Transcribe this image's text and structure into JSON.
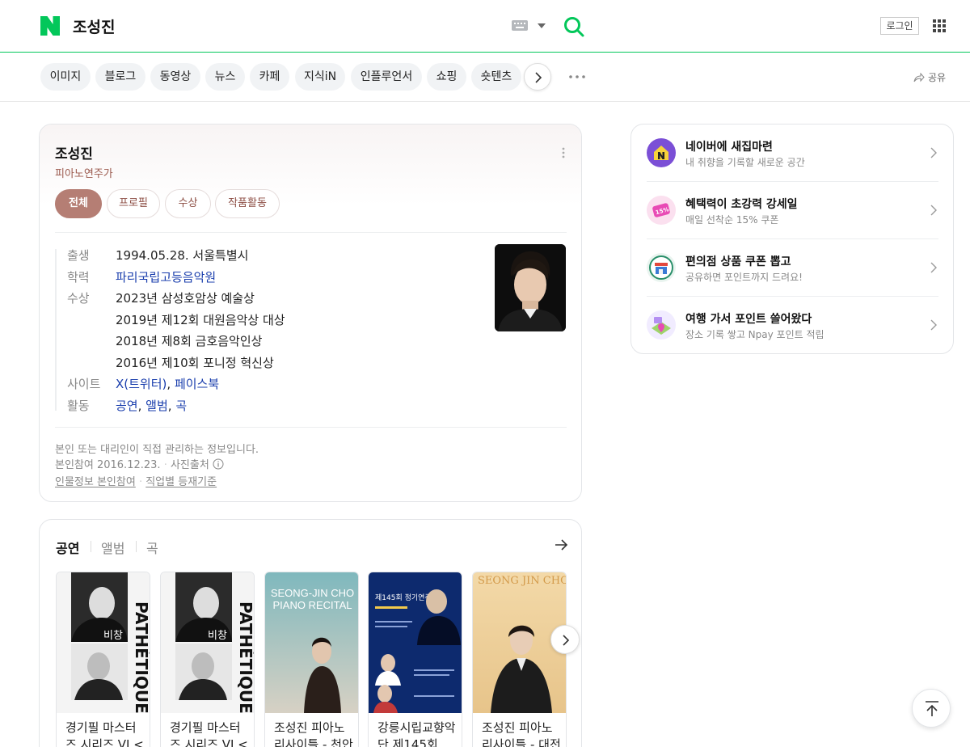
{
  "header": {
    "query": "조성진",
    "login_label": "로그인"
  },
  "tabs": [
    "이미지",
    "블로그",
    "동영상",
    "뉴스",
    "카페",
    "지식iN",
    "인플루언서",
    "쇼핑",
    "숏텐츠"
  ],
  "share_label": "공유",
  "profile": {
    "name": "조성진",
    "job": "피아노연주가",
    "tabs": [
      "전체",
      "프로필",
      "수상",
      "작품활동"
    ],
    "rows": {
      "birth_label": "출생",
      "birth_value": "1994.05.28. 서울특별시",
      "edu_label": "학력",
      "edu_value": "파리국립고등음악원",
      "award_label": "수상",
      "awards": [
        "2023년 삼성호암상 예술상",
        "2019년 제12회 대원음악상 대상",
        "2018년 제8회 금호음악인상",
        "2016년 제10회 포니정 혁신상"
      ],
      "site_label": "사이트",
      "site_links": [
        "X(트위터)",
        "페이스북"
      ],
      "activity_label": "활동",
      "activity_links": [
        "공연",
        "앨범",
        "곡"
      ]
    },
    "footer": {
      "line1": "본인 또는 대리인이 직접 관리하는 정보입니다.",
      "line2_date": "본인참여 2016.12.23.",
      "line2_photo": "사진출처",
      "link1": "인물정보 본인참여",
      "link2": "직업별 등재기준"
    }
  },
  "performances": {
    "tabs": [
      "공연",
      "앨범",
      "곡"
    ],
    "items": [
      {
        "caption": "경기필 마스터즈 시리즈 VI <비...",
        "poster_text": "PATHÉTIQUE",
        "poster_sub": "비창"
      },
      {
        "caption": "경기필 마스터즈 시리즈 VI <비...",
        "poster_text": "PATHÉTIQUE",
        "poster_sub": "비창"
      },
      {
        "caption": "조성진 피아노 리사이틀 - 천안",
        "poster_text": "SEONG-JIN CHO PIANO RECITAL",
        "poster_sub": "조성진 피아노 리사이틀"
      },
      {
        "caption": "강릉시립교향악단 제145회 ...",
        "poster_text": "제145회 정기연주회",
        "poster_sub": ""
      },
      {
        "caption": "조성진 피아노 리사이틀 - 대전",
        "poster_text": "SEONG JIN CHO",
        "poster_sub": ""
      }
    ]
  },
  "side": {
    "items": [
      {
        "title": "네이버에 새집마련",
        "sub": "내 취향을 기록할 새로운 공간"
      },
      {
        "title": "혜택력이 초강력 강세일",
        "sub": "매일 선착순 15% 쿠폰",
        "badge": "15%"
      },
      {
        "title": "편의점 상품 쿠폰 뽑고",
        "sub": "공유하면 포인트까지 드려요!"
      },
      {
        "title": "여행 가서 포인트 쓸어왔다",
        "sub": "장소 기록 쌓고 Npay 포인트 적립"
      }
    ]
  },
  "colors": {
    "brand": "#03c75a",
    "accent": "#b57e74",
    "link": "#1a3ead"
  }
}
